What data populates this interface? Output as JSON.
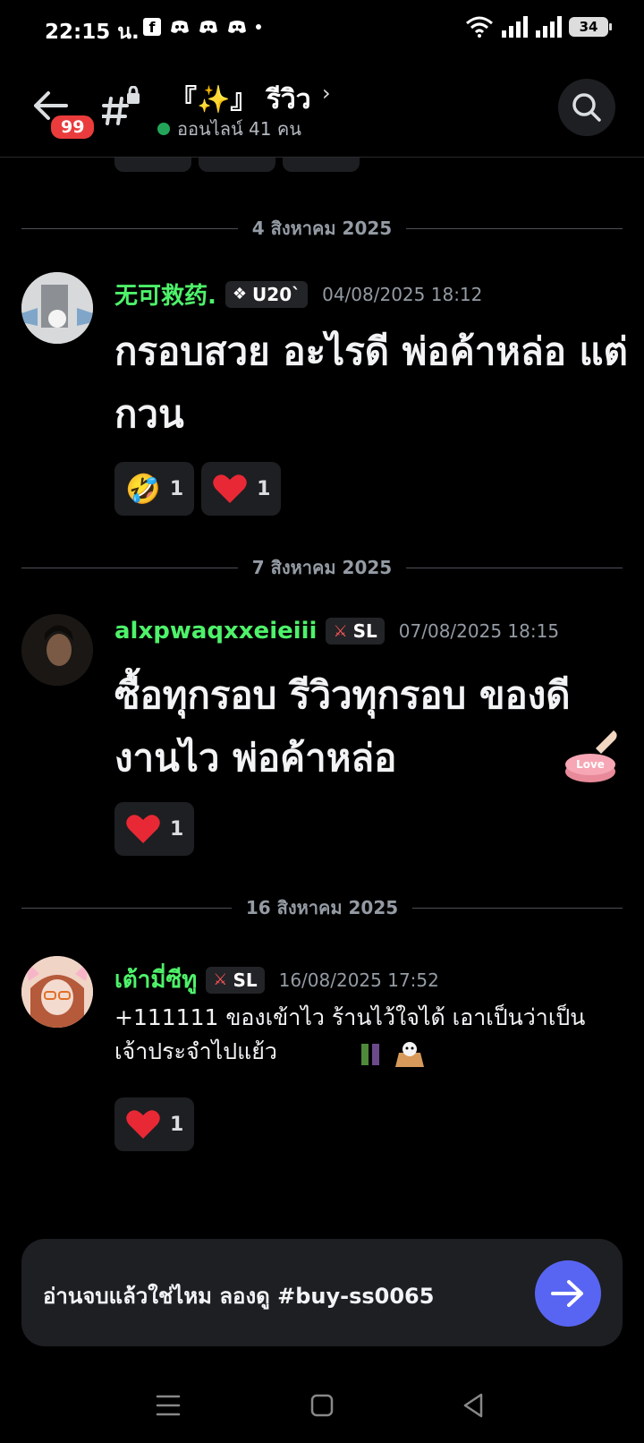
{
  "status_bar": {
    "time": "22:15 น.",
    "battery": "34"
  },
  "header": {
    "unread_badge": "99",
    "channel_title": "『✨』 รีวิว",
    "online_text": "ออนไลน์ 41 คน"
  },
  "feed": {
    "messages": [
      {
        "date": "4 สิงหาคม 2025",
        "username": "无可救药.",
        "role": "U20`",
        "timestamp": "04/08/2025 18:12",
        "text": "กรอบสวย อะไรดี พ่อค้าหล่อ แต่กวน",
        "reactions": [
          {
            "emoji": "🤣",
            "count": "1"
          },
          {
            "emoji": "❤️",
            "count": "1"
          }
        ]
      },
      {
        "date": "7 สิงหาคม 2025",
        "username": "alxpwaqxxeieiii",
        "role": "SL",
        "timestamp": "07/08/2025 18:15",
        "text": "ซื้อทุกรอบ รีวิวทุกรอบ ของดี งานไว พ่อค้าหล่อ",
        "reactions": [
          {
            "emoji": "❤️",
            "count": "1"
          }
        ]
      },
      {
        "date": "16 สิงหาคม 2025",
        "username": "เต้ามี่ซีทู",
        "role": "SL",
        "timestamp": "16/08/2025 17:52",
        "text": "+111111 ของเข้าไว ร้านไว้ใจได้ เอาเป็นว่าเป็นเจ้าประจำไปแย้ว",
        "reactions": [
          {
            "emoji": "❤️",
            "count": "1"
          }
        ]
      }
    ]
  },
  "composer": {
    "text": "อ่านจบแล้วใช่ไหม ลองดู #buy-ss0065"
  },
  "colors": {
    "username": "#4ef26a",
    "online": "#23a559",
    "send": "#5865f2",
    "badge": "#ea3c3c"
  },
  "icons": [
    "back-arrow-icon",
    "locked-channel-icon",
    "chevron-right-icon",
    "search-icon",
    "send-arrow-icon",
    "menu-icon",
    "home-square-icon",
    "back-triangle-icon"
  ]
}
